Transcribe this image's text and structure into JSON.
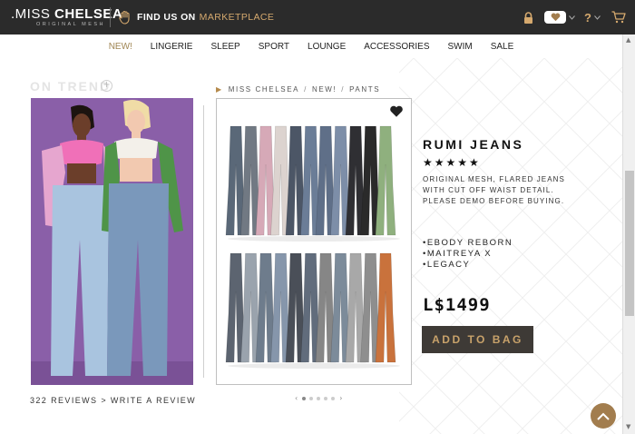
{
  "header": {
    "brand_prefix": ".MISS",
    "brand_name": "CHELSEA",
    "brand_tagline": "ORIGINAL MESH",
    "find_us": "FIND US ON",
    "find_us_highlight": "MARKETPLACE",
    "help_label": "?",
    "colors": {
      "bar": "#2b2b2b",
      "accent": "#d5a96e"
    }
  },
  "nav": {
    "items": [
      {
        "label": "NEW!",
        "active": true
      },
      {
        "label": "LINGERIE"
      },
      {
        "label": "SLEEP"
      },
      {
        "label": "SPORT"
      },
      {
        "label": "LOUNGE"
      },
      {
        "label": "ACCESSORIES"
      },
      {
        "label": "SWIM"
      },
      {
        "label": "SALE"
      }
    ]
  },
  "on_trend": {
    "title": "ON TREND",
    "reviews_count": "322",
    "reviews_label": "REVIEWS",
    "separator": ">",
    "write_review": "WRITE A REVIEW"
  },
  "breadcrumb": {
    "items": [
      "MISS CHELSEA",
      "NEW!",
      "PANTS"
    ],
    "separator": "/"
  },
  "product": {
    "title": "RUMI JEANS",
    "rating": 5,
    "stars": "★★★★★",
    "description_lines": [
      "ORIGINAL MESH, FLARED JEANS",
      "WITH CUT OFF WAIST DETAIL.",
      "PLEASE DEMO BEFORE BUYING."
    ],
    "compat": [
      "•EBODY REBORN",
      "•MAITREYA X",
      "•LEGACY"
    ],
    "price": "L$1499",
    "add_to_bag": "ADD TO BAG",
    "row1_colors": [
      "#8fb07e",
      "#2a2a2a",
      "#2f2f33",
      "#7d8ea8",
      "#5f6f88",
      "#6b7d97",
      "#4c5666",
      "#dcd3cf",
      "#d6a9b7",
      "#717983",
      "#5a6878"
    ],
    "row2_colors": [
      "#c9723c",
      "#8e8e8e",
      "#a8a8a8",
      "#7c8b9a",
      "#868686",
      "#616c7c",
      "#4a4f58",
      "#8696ab",
      "#6e7c8c",
      "#9aa3ad",
      "#5c6470"
    ]
  },
  "carousel": {
    "slides": 5,
    "active": 1,
    "prev": "‹",
    "next": "›"
  },
  "colors": {
    "gold_button_text": "#c8a26a",
    "button_bg": "#3e3a36",
    "trend_bg": "#8a5fa8"
  }
}
